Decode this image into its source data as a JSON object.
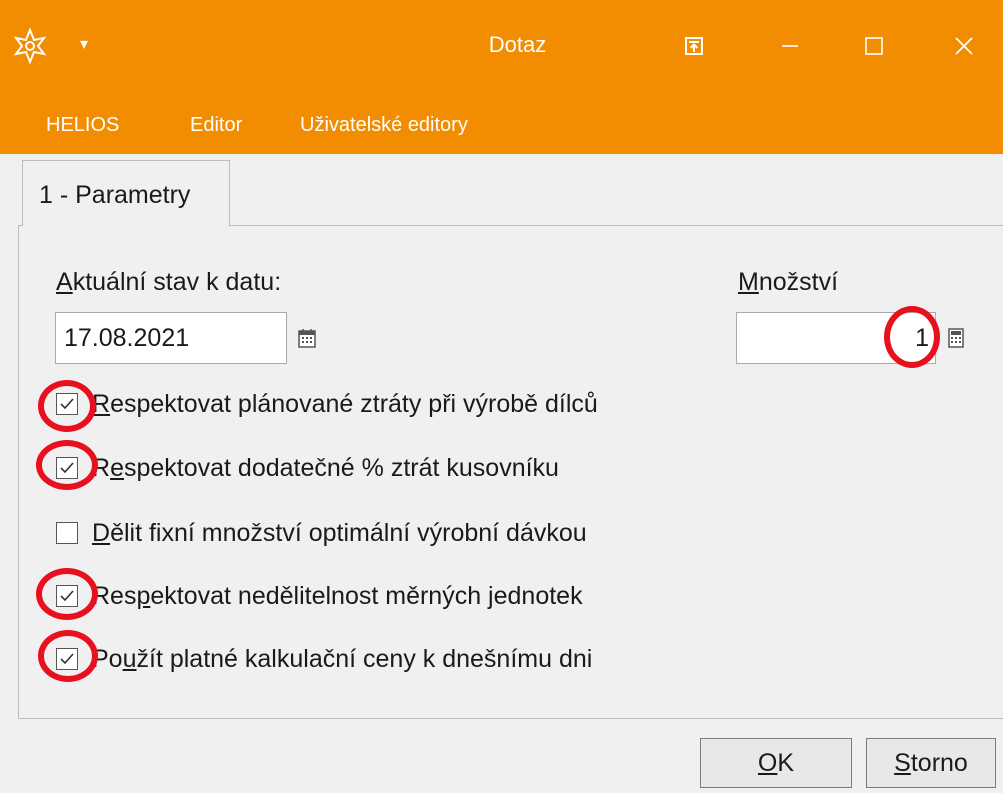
{
  "window": {
    "title": "Dotaz",
    "app_icon": "helios-star-icon",
    "quick_access": "▾",
    "controls": {
      "pin": "pin-icon",
      "minimize": "—",
      "maximize": "☐",
      "close": "✕"
    }
  },
  "menu": {
    "items": [
      "HELIOS",
      "Editor",
      "Uživatelské editory"
    ]
  },
  "tab": {
    "label": "1 - Parametry"
  },
  "form": {
    "date": {
      "label_first": "A",
      "label_rest": "ktuální stav k datu:",
      "value": "17.08.2021",
      "button_icon": "calendar-icon"
    },
    "quantity": {
      "label_first": "M",
      "label_rest": "nožství",
      "value": "1",
      "button_icon": "calculator-icon"
    },
    "checkboxes": [
      {
        "pre": "",
        "u": "R",
        "post": "espektovat plánované ztráty při výrobě dílců",
        "checked": true
      },
      {
        "pre": "R",
        "u": "e",
        "post": "spektovat dodatečné % ztrát kusovníku",
        "checked": true
      },
      {
        "pre": "",
        "u": "D",
        "post": "ělit fixní množství optimální výrobní dávkou",
        "checked": false
      },
      {
        "pre": "Res",
        "u": "p",
        "post": "ektovat nedělitelnost měrných jednotek",
        "checked": true
      },
      {
        "pre": "Po",
        "u": "u",
        "post": "žít platné kalkulační ceny k dnešnímu dni",
        "checked": true
      }
    ]
  },
  "buttons": {
    "ok": {
      "u": "O",
      "rest": "K"
    },
    "cancel": {
      "u": "S",
      "rest": "torno"
    }
  },
  "annotation_color": "#e8101e",
  "accent_color": "#f28c00"
}
